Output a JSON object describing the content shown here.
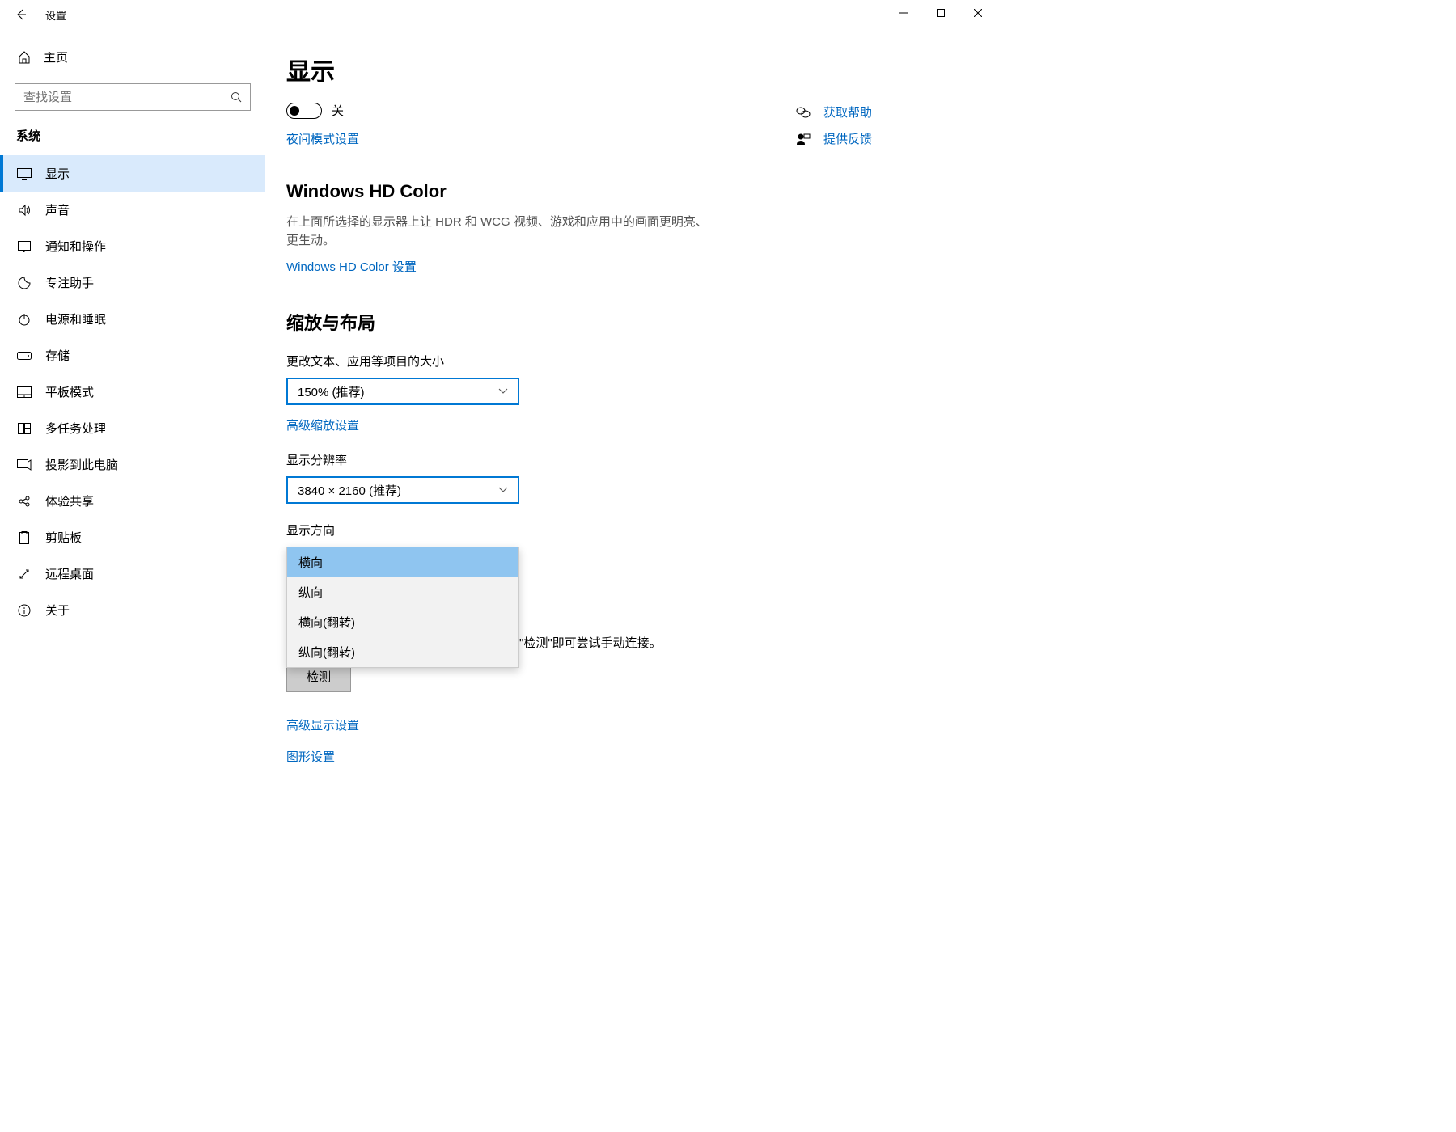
{
  "app_title": "设置",
  "home_label": "主页",
  "search_placeholder": "查找设置",
  "section_title": "系统",
  "nav": [
    {
      "label": "显示"
    },
    {
      "label": "声音"
    },
    {
      "label": "通知和操作"
    },
    {
      "label": "专注助手"
    },
    {
      "label": "电源和睡眠"
    },
    {
      "label": "存储"
    },
    {
      "label": "平板模式"
    },
    {
      "label": "多任务处理"
    },
    {
      "label": "投影到此电脑"
    },
    {
      "label": "体验共享"
    },
    {
      "label": "剪贴板"
    },
    {
      "label": "远程桌面"
    },
    {
      "label": "关于"
    }
  ],
  "page": {
    "title": "显示",
    "toggle_off": "关",
    "night_link": "夜间模式设置",
    "hdcolor_title": "Windows HD Color",
    "hdcolor_desc": "在上面所选择的显示器上让 HDR 和 WCG 视频、游戏和应用中的画面更明亮、更生动。",
    "hdcolor_link": "Windows HD Color 设置",
    "scale_title": "缩放与布局",
    "scale_label": "更改文本、应用等项目的大小",
    "scale_value": "150% (推荐)",
    "adv_scale_link": "高级缩放设置",
    "res_label": "显示分辨率",
    "res_value": "3840 × 2160 (推荐)",
    "orient_label": "显示方向",
    "orient_options": [
      "横向",
      "纵向",
      "横向(翻转)",
      "纵向(翻转)"
    ],
    "detect_text": "\"检测\"即可尝试手动连接。",
    "detect_btn": "检测",
    "adv_display_link": "高级显示设置",
    "graphics_link": "图形设置"
  },
  "side": {
    "get_help": "获取帮助",
    "feedback": "提供反馈"
  }
}
